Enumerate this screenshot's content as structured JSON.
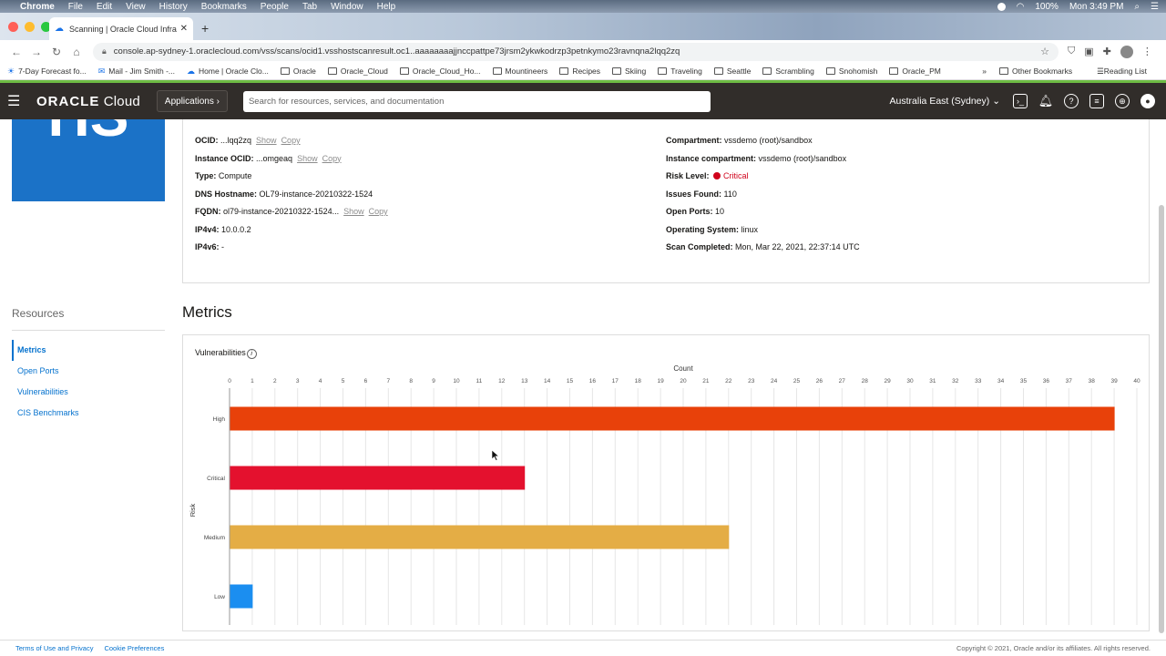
{
  "mac_menubar": {
    "app": "Chrome",
    "menus": [
      "File",
      "Edit",
      "View",
      "History",
      "Bookmarks",
      "People",
      "Tab",
      "Window",
      "Help"
    ],
    "battery": "100%",
    "clock": "Mon 3:49 PM"
  },
  "browser": {
    "tab_title": "Scanning | Oracle Cloud Infras",
    "url": "console.ap-sydney-1.oraclecloud.com/vss/scans/ocid1.vsshostscanresult.oc1..aaaaaaaajjnccpattpe73jrsm2ykwkodrzp3petnkymo23ravnqna2lqq2zq",
    "bookmarks": [
      {
        "label": "7-Day Forecast fo...",
        "icon": "weather-icon"
      },
      {
        "label": "Mail - Jim Smith -...",
        "icon": "outlook-icon"
      },
      {
        "label": "Home | Oracle Clo...",
        "icon": "cloud-icon"
      },
      {
        "label": "Oracle",
        "icon": "folder-icon"
      },
      {
        "label": "Oracle_Cloud",
        "icon": "folder-icon"
      },
      {
        "label": "Oracle_Cloud_Ho...",
        "icon": "folder-icon"
      },
      {
        "label": "Mountineers",
        "icon": "folder-icon"
      },
      {
        "label": "Recipes",
        "icon": "folder-icon"
      },
      {
        "label": "Skiing",
        "icon": "folder-icon"
      },
      {
        "label": "Traveling",
        "icon": "folder-icon"
      },
      {
        "label": "Seattle",
        "icon": "folder-icon"
      },
      {
        "label": "Scrambling",
        "icon": "folder-icon"
      },
      {
        "label": "Snohomish",
        "icon": "folder-icon"
      },
      {
        "label": "Oracle_PM",
        "icon": "folder-icon"
      }
    ],
    "bookmarks_overflow": "»",
    "other_bookmarks": "Other Bookmarks",
    "reading_list": "Reading List"
  },
  "oci_header": {
    "logo_brand": "ORACLE",
    "logo_product": "Cloud",
    "applications_label": "Applications",
    "search_placeholder": "Search for resources, services, and documentation",
    "region": "Australia East (Sydney)"
  },
  "host": {
    "tile_text": "HS",
    "left": [
      {
        "label": "OCID:",
        "value": "...lqq2zq",
        "links": [
          "Show",
          "Copy"
        ]
      },
      {
        "label": "Instance OCID:",
        "value": "...omgeaq",
        "links": [
          "Show",
          "Copy"
        ]
      },
      {
        "label": "Type:",
        "value": "Compute"
      },
      {
        "label": "DNS Hostname:",
        "value": "OL79-instance-20210322-1524"
      },
      {
        "label": "FQDN:",
        "value": "ol79-instance-20210322-1524...",
        "links": [
          "Show",
          "Copy"
        ]
      },
      {
        "label": "IP4v4:",
        "value": "10.0.0.2"
      },
      {
        "label": "IP4v6:",
        "value": "-"
      }
    ],
    "right": [
      {
        "label": "Compartment:",
        "value": "vssdemo (root)/sandbox"
      },
      {
        "label": "Instance compartment:",
        "value": "vssdemo (root)/sandbox"
      },
      {
        "label": "Risk Level:",
        "value": "Critical",
        "status_color": "#d0021b"
      },
      {
        "label": "Issues Found:",
        "value": "110"
      },
      {
        "label": "Open Ports:",
        "value": "10"
      },
      {
        "label": "Operating System:",
        "value": "linux"
      },
      {
        "label": "Scan Completed:",
        "value": "Mon, Mar 22, 2021, 22:37:14 UTC"
      }
    ]
  },
  "resources": {
    "title": "Resources",
    "items": [
      "Metrics",
      "Open Ports",
      "Vulnerabilities",
      "CIS Benchmarks"
    ],
    "active": "Metrics"
  },
  "metrics": {
    "title": "Metrics",
    "panel_label": "Vulnerabilities"
  },
  "chart_data": {
    "type": "bar",
    "orientation": "horizontal",
    "xlabel": "Count",
    "ylabel": "Risk",
    "xlim": [
      0,
      40
    ],
    "x_ticks": [
      0,
      1,
      2,
      3,
      4,
      5,
      6,
      7,
      8,
      9,
      10,
      11,
      12,
      13,
      14,
      15,
      16,
      17,
      18,
      19,
      20,
      21,
      22,
      23,
      24,
      25,
      26,
      27,
      28,
      29,
      30,
      31,
      32,
      33,
      34,
      35,
      36,
      37,
      38,
      39,
      40
    ],
    "categories": [
      "High",
      "Critical",
      "Medium",
      "Low"
    ],
    "values": [
      39,
      13,
      22,
      1
    ],
    "colors": [
      "#e8410a",
      "#e4112e",
      "#e4ad45",
      "#1b8ef0"
    ],
    "grid": true,
    "xaxis_position": "top"
  },
  "footer": {
    "terms": "Terms of Use and Privacy",
    "cookies": "Cookie Preferences",
    "copyright": "Copyright © 2021, Oracle and/or its affiliates. All rights reserved."
  }
}
